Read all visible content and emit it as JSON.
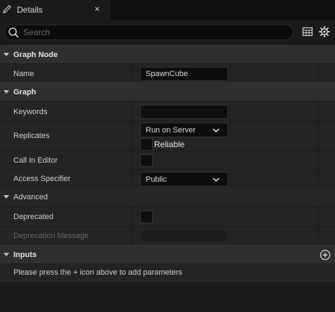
{
  "tab": {
    "title": "Details",
    "icon": "pencil-icon",
    "close_glyph": "×"
  },
  "search": {
    "placeholder": "Search",
    "value": ""
  },
  "toolbar": {
    "table_icon": "table-view-icon",
    "settings_icon": "gear-icon"
  },
  "categories": {
    "graph_node": {
      "label": "Graph Node"
    },
    "graph": {
      "label": "Graph"
    },
    "advanced": {
      "label": "Advanced"
    },
    "inputs": {
      "label": "Inputs",
      "hint": "Please press the + icon above to add parameters"
    }
  },
  "properties": {
    "name": {
      "label": "Name",
      "value": "SpawnCube"
    },
    "keywords": {
      "label": "Keywords",
      "value": ""
    },
    "replicates": {
      "label": "Replicates",
      "value": "Run on Server",
      "reliable_label": "Reliable",
      "reliable_checked": false
    },
    "call_in_editor": {
      "label": "Call In Editor",
      "checked": false
    },
    "access_specifier": {
      "label": "Access Specifier",
      "value": "Public"
    },
    "deprecated": {
      "label": "Deprecated",
      "checked": false
    },
    "deprecation_message": {
      "label": "Deprecation Message",
      "value": ""
    }
  },
  "colors": {
    "background": "#1a1a1a",
    "category": "#2f2f2f",
    "row": "#242424",
    "field": "#0e0e0e",
    "text": "#cfcfcf"
  }
}
